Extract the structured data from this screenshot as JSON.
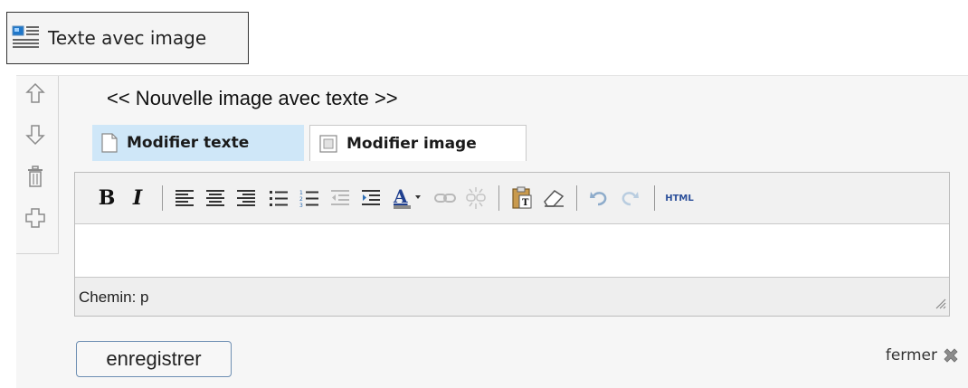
{
  "toggle": {
    "label": "Texte avec image",
    "icon": "image-text-icon"
  },
  "block": {
    "title": "<< Nouvelle image avec texte >>",
    "side_tools": [
      "arrow-up-icon",
      "arrow-down-icon",
      "trash-icon",
      "move-cross-icon"
    ]
  },
  "tabs": [
    {
      "label": "Modifier texte",
      "icon": "page-icon",
      "active": true
    },
    {
      "label": "Modifier image",
      "icon": "image-icon",
      "active": false
    }
  ],
  "toolbar": {
    "bold": "B",
    "italic": "I",
    "html": "HTML",
    "buttons": [
      "bold-button",
      "italic-button",
      "align-left-button",
      "align-center-button",
      "align-right-button",
      "bullet-list-button",
      "numbered-list-button",
      "outdent-button",
      "indent-button",
      "text-color-button",
      "link-button",
      "unlink-button",
      "paste-text-button",
      "eraser-button",
      "undo-button",
      "redo-button",
      "html-source-button"
    ]
  },
  "editor": {
    "content": "",
    "path_label": "Chemin: p"
  },
  "actions": {
    "save_label": "enregistrer",
    "close_label": "fermer"
  },
  "colors": {
    "tab_active": "#cfe7f8",
    "panel": "#f6f6f6",
    "button_border": "#6e8fb3"
  }
}
